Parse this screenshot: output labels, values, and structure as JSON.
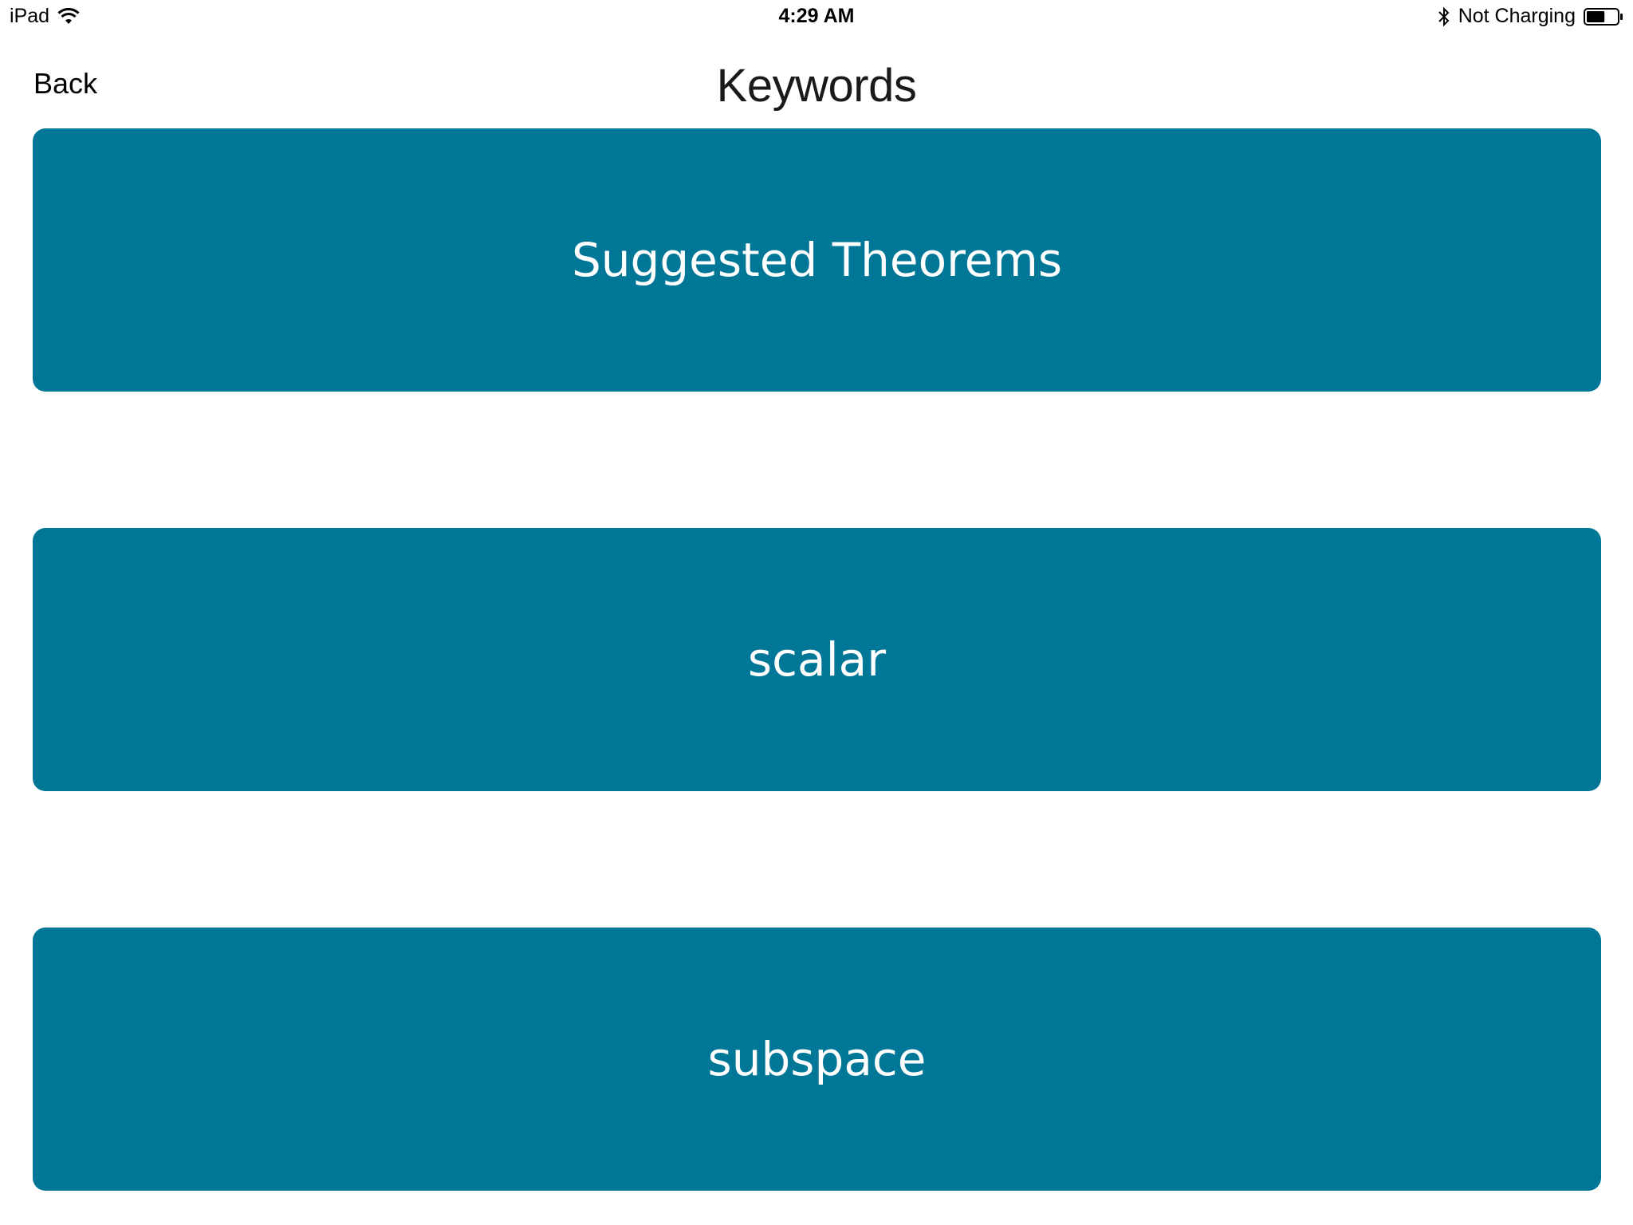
{
  "status_bar": {
    "device": "iPad",
    "time": "4:29 AM",
    "battery_status": "Not Charging",
    "battery_level_fraction": 0.6
  },
  "nav": {
    "back_label": "Back",
    "title": "Keywords"
  },
  "keywords": [
    {
      "label": "Suggested Theorems"
    },
    {
      "label": "scalar"
    },
    {
      "label": "subspace"
    }
  ],
  "colors": {
    "button_background": "#007797",
    "button_text": "#ffffff",
    "page_background": "#ffffff"
  },
  "icons": {
    "wifi": "wifi-icon",
    "bluetooth": "bluetooth-icon",
    "battery": "battery-icon"
  }
}
